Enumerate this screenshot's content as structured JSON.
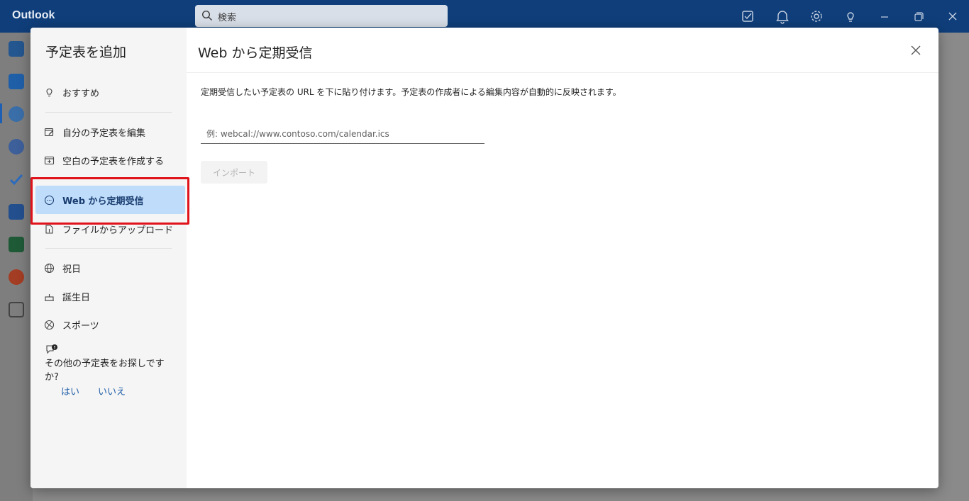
{
  "app": {
    "title": "Outlook"
  },
  "search": {
    "placeholder": "検索"
  },
  "topbar_icons": [
    "my-day-icon",
    "bell-icon",
    "gear-icon",
    "lightbulb-icon",
    "minimize-icon",
    "restore-icon",
    "close-icon"
  ],
  "rail_icons": [
    "mail-icon",
    "calendar-icon",
    "people-icon",
    "groups-icon",
    "todo-icon",
    "word-icon",
    "excel-icon",
    "powerpoint-icon",
    "more-apps-icon"
  ],
  "dialog": {
    "side_title": "予定表を追加",
    "items": [
      {
        "label": "おすすめ",
        "icon": "lightbulb-icon"
      },
      {
        "label": "自分の予定表を編集",
        "icon": "edit-calendar-icon"
      },
      {
        "label": "空白の予定表を作成する",
        "icon": "add-calendar-icon"
      },
      {
        "label": "Web から定期受信",
        "icon": "web-subscribe-icon",
        "selected": true
      },
      {
        "label": "ファイルからアップロード",
        "icon": "upload-icon"
      },
      {
        "label": "祝日",
        "icon": "globe-icon"
      },
      {
        "label": "誕生日",
        "icon": "cake-icon"
      },
      {
        "label": "スポーツ",
        "icon": "sports-icon"
      }
    ],
    "feedback": {
      "question": "その他の予定表をお探しですか?",
      "yes": "はい",
      "no": "いいえ"
    },
    "header_title": "Web から定期受信",
    "description": "定期受信したい予定表の URL を下に貼り付けます。予定表の作成者による編集内容が自動的に反映されます。",
    "url_placeholder": "例: webcal://www.contoso.com/calendar.ics",
    "import_label": "インポート"
  },
  "colors": {
    "topbar": "#0f3e7a",
    "selected_bg": "#bfdcfb",
    "highlight_border": "#e0131b",
    "link": "#1f5ea8"
  }
}
